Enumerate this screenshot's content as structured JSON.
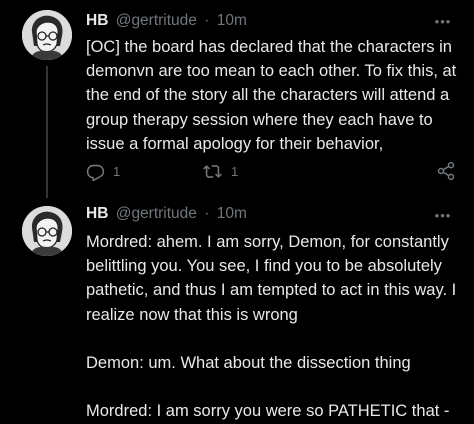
{
  "tweets": [
    {
      "name": "HB",
      "handle": "@gertritude",
      "separator": "·",
      "time": "10m",
      "text": "[OC] the board has declared that the characters in demonvn are too mean to each other.  To fix this, at the end of the story all the characters will attend a group therapy session where they each have to issue a formal apology for their behavior,",
      "more_label": "•••",
      "reply_count": "1",
      "retweet_count": "1",
      "icons": {
        "reply": "reply-icon",
        "retweet": "retweet-icon",
        "share": "share-icon"
      }
    },
    {
      "name": "HB",
      "handle": "@gertritude",
      "separator": "·",
      "time": "10m",
      "text": "Mordred: ahem. I am sorry, Demon, for constantly belittling you. You see, I find you to be absolutely pathetic, and thus I am tempted to act in this way. I realize now that this is wrong\n\nDemon: um.  What about the dissection thing\n\nMordred: I am sorry you were so PATHETIC that -",
      "more_label": "•••"
    }
  ],
  "colors": {
    "background": "#000000",
    "text_primary": "#e7e9ea",
    "text_secondary": "#71767b",
    "thread_line": "#333639"
  }
}
